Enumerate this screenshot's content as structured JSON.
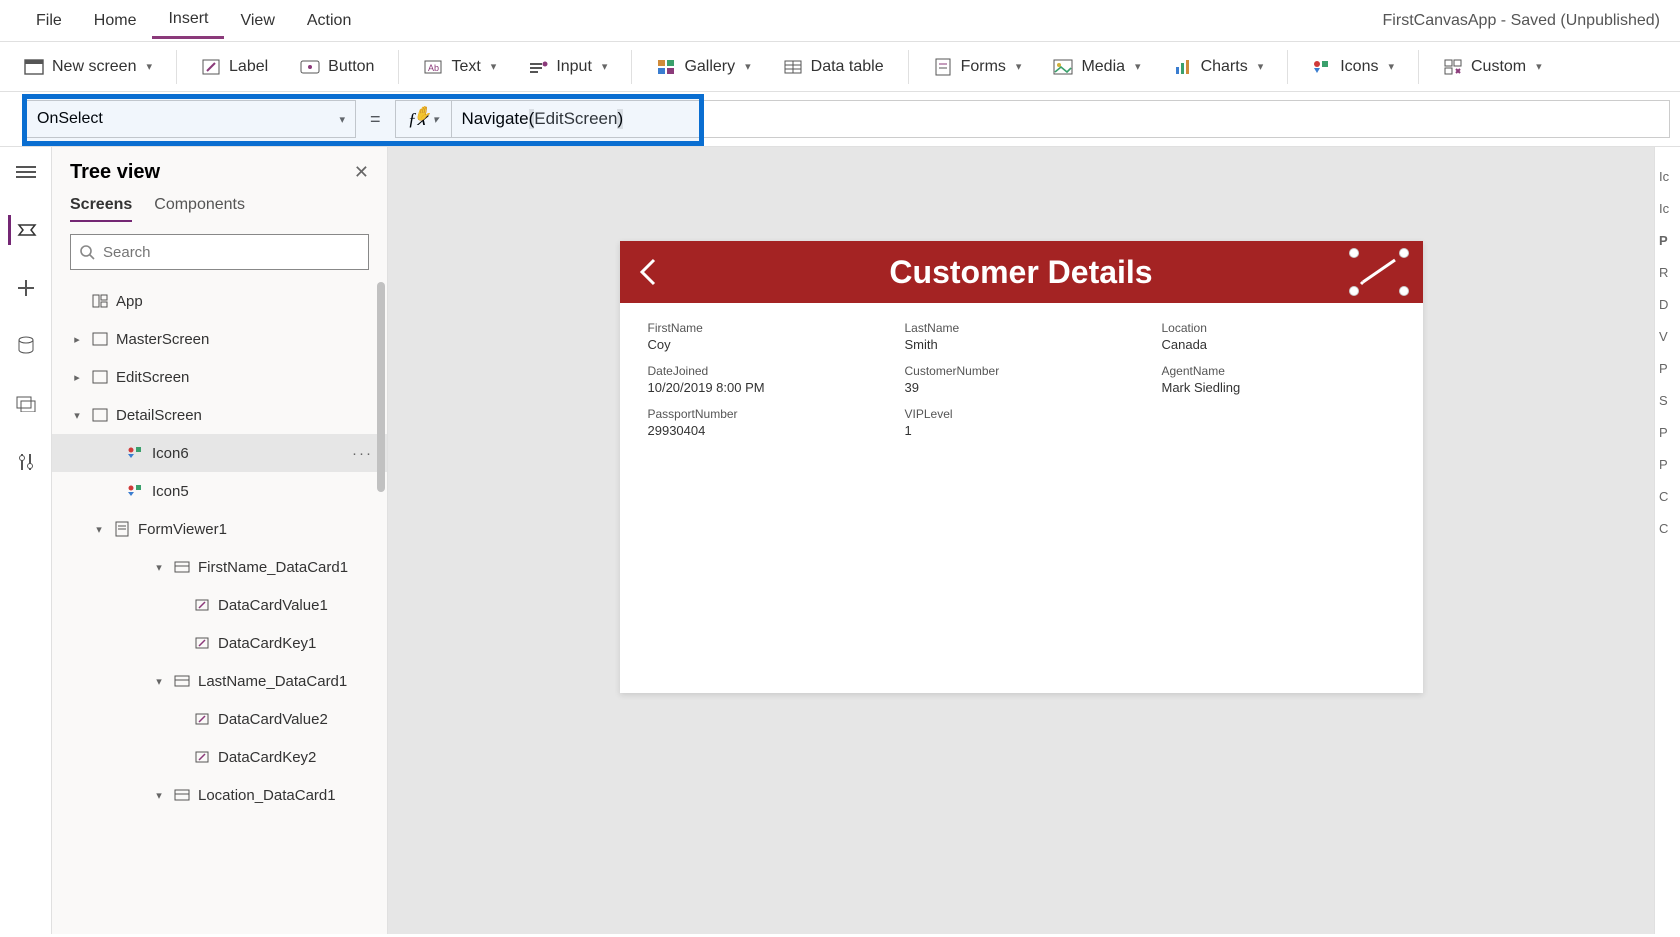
{
  "app_title": "FirstCanvasApp - Saved (Unpublished)",
  "menu": {
    "file": "File",
    "home": "Home",
    "insert": "Insert",
    "view": "View",
    "action": "Action"
  },
  "ribbon": {
    "new_screen": "New screen",
    "label": "Label",
    "button": "Button",
    "text": "Text",
    "input": "Input",
    "gallery": "Gallery",
    "data_table": "Data table",
    "forms": "Forms",
    "media": "Media",
    "charts": "Charts",
    "icons": "Icons",
    "custom": "Custom"
  },
  "formula": {
    "property": "OnSelect",
    "equals": "=",
    "fx": "fx",
    "func": "Navigate",
    "open": "(",
    "arg": "EditScreen",
    "close": ")"
  },
  "tree": {
    "title": "Tree view",
    "tab_screens": "Screens",
    "tab_components": "Components",
    "search_placeholder": "Search",
    "app": "App",
    "master": "MasterScreen",
    "edit": "EditScreen",
    "detail": "DetailScreen",
    "icon6": "Icon6",
    "icon5": "Icon5",
    "formviewer1": "FormViewer1",
    "first_dc": "FirstName_DataCard1",
    "dcv1": "DataCardValue1",
    "dck1": "DataCardKey1",
    "last_dc": "LastName_DataCard1",
    "dcv2": "DataCardValue2",
    "dck2": "DataCardKey2",
    "loc_dc": "Location_DataCard1"
  },
  "canvas": {
    "header_title": "Customer Details",
    "fields": {
      "first_l": "FirstName",
      "first_v": "Coy",
      "last_l": "LastName",
      "last_v": "Smith",
      "loc_l": "Location",
      "loc_v": "Canada",
      "date_l": "DateJoined",
      "date_v": "10/20/2019 8:00 PM",
      "cust_l": "CustomerNumber",
      "cust_v": "39",
      "agent_l": "AgentName",
      "agent_v": "Mark Siedling",
      "pass_l": "PassportNumber",
      "pass_v": "29930404",
      "vip_l": "VIPLevel",
      "vip_v": "1"
    }
  },
  "rp": [
    "Ic",
    "Ic",
    "P",
    "",
    "R",
    "D",
    "",
    "V",
    "",
    "P",
    "",
    "S",
    "",
    "P",
    "",
    "P",
    "",
    "",
    "C",
    "",
    "C"
  ]
}
